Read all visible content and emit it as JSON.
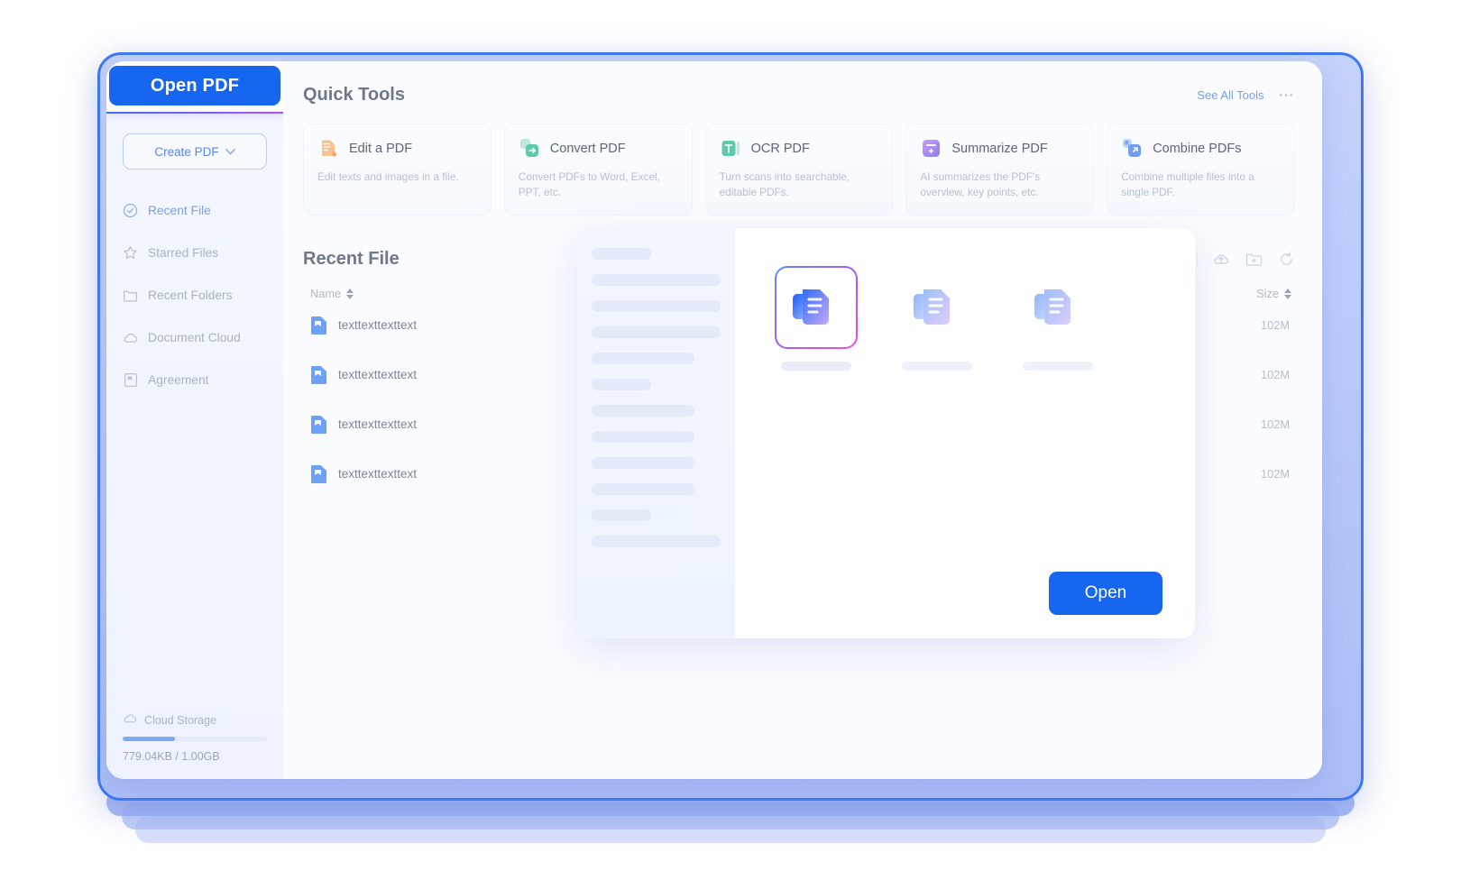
{
  "sidebar": {
    "open_pdf_label": "Open PDF",
    "create_pdf_label": "Create PDF",
    "create_pdf_chevron": "chevron-down-icon",
    "items": [
      {
        "label": "Recent File",
        "icon": "clock-check-icon",
        "active": true
      },
      {
        "label": "Starred Files",
        "icon": "star-icon",
        "active": false
      },
      {
        "label": "Recent Folders",
        "icon": "folder-icon",
        "active": false
      },
      {
        "label": "Document Cloud",
        "icon": "cloud-icon",
        "active": false
      },
      {
        "label": "Agreement",
        "icon": "document-icon",
        "active": false
      }
    ],
    "cloud_storage": {
      "label": "Cloud Storage",
      "icon": "cloud-icon",
      "usage_text": "779.04KB / 1.00GB",
      "percent": 36
    }
  },
  "quick_tools": {
    "title": "Quick Tools",
    "see_all_label": "See All Tools",
    "more_label": "⋯",
    "cards": [
      {
        "name": "Edit a PDF",
        "desc": "Edit texts and images in a file.",
        "icon": "edit-pdf-icon",
        "color": "#f6b880"
      },
      {
        "name": "Convert PDF",
        "desc": "Convert PDFs to Word, Excel, PPT, etc.",
        "icon": "convert-pdf-icon",
        "color": "#6fcfb8"
      },
      {
        "name": "OCR PDF",
        "desc": "Turn scans into searchable, editable PDFs.",
        "icon": "ocr-pdf-icon",
        "color": "#5ec9ac"
      },
      {
        "name": "Summarize PDF",
        "desc": "AI summarizes the PDF's overview, key points, etc.",
        "icon": "summarize-pdf-icon",
        "color": "#b08cf0"
      },
      {
        "name": "Combine PDFs",
        "desc": "Combine multiple files into a single PDF.",
        "icon": "combine-pdfs-icon",
        "color": "#6f9ef5"
      }
    ]
  },
  "recent_file": {
    "title": "Recent File",
    "search_placeholder": "",
    "toolbar_icons": [
      {
        "name": "list-view-icon"
      },
      {
        "name": "grid-view-icon"
      },
      {
        "name": "cloud-upload-icon"
      },
      {
        "name": "new-folder-icon"
      },
      {
        "name": "refresh-icon"
      }
    ],
    "columns": {
      "name": "Name",
      "size": "Size"
    },
    "rows": [
      {
        "name": "texttexttexttext",
        "size": "102M",
        "icon": "pdf-file-icon"
      },
      {
        "name": "texttexttexttext",
        "size": "102M",
        "icon": "pdf-file-icon"
      },
      {
        "name": "texttexttexttext",
        "size": "102M",
        "icon": "pdf-file-icon"
      },
      {
        "name": "texttexttexttext",
        "size": "102M",
        "icon": "pdf-file-icon"
      }
    ]
  },
  "modal": {
    "open_button_label": "Open",
    "documents": [
      {
        "icon": "document-thumb-icon",
        "selected": true
      },
      {
        "icon": "document-thumb-icon",
        "selected": false
      },
      {
        "icon": "document-thumb-icon",
        "selected": false
      }
    ]
  },
  "colors": {
    "primary_blue": "#1766f0",
    "accent_gradient_start": "#3b6df5",
    "accent_gradient_end": "#e056d9",
    "link_blue": "#6fa0f2",
    "muted_text": "#b0b9ca"
  }
}
